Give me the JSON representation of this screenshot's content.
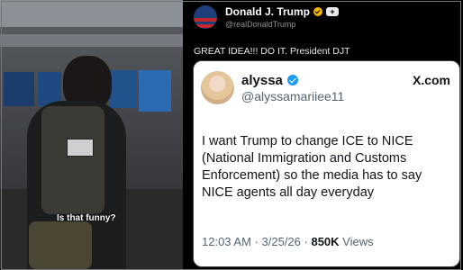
{
  "post": {
    "author_name": "Donald J. Trump",
    "author_handle": "@realDonaldTrump",
    "text": "GREAT IDEA!!! DO IT. President DJT"
  },
  "quote": {
    "author_name": "alyssa",
    "author_handle": "@alyssamariiee11",
    "platform": "X.com",
    "body": "I want Trump to change ICE to NICE (National Immigration and Customs Enforcement) so the media has to say NICE agents all day everyday",
    "time": "12:03 AM",
    "date": "3/25/26",
    "views_count": "850K",
    "views_label": "Views"
  },
  "video": {
    "subtitle": "Is that funny?"
  },
  "colors": {
    "background": "#000000",
    "quote_background": "#ffffff",
    "verified_blue": "#1d9bf0",
    "gold_badge": "#f4b400"
  }
}
